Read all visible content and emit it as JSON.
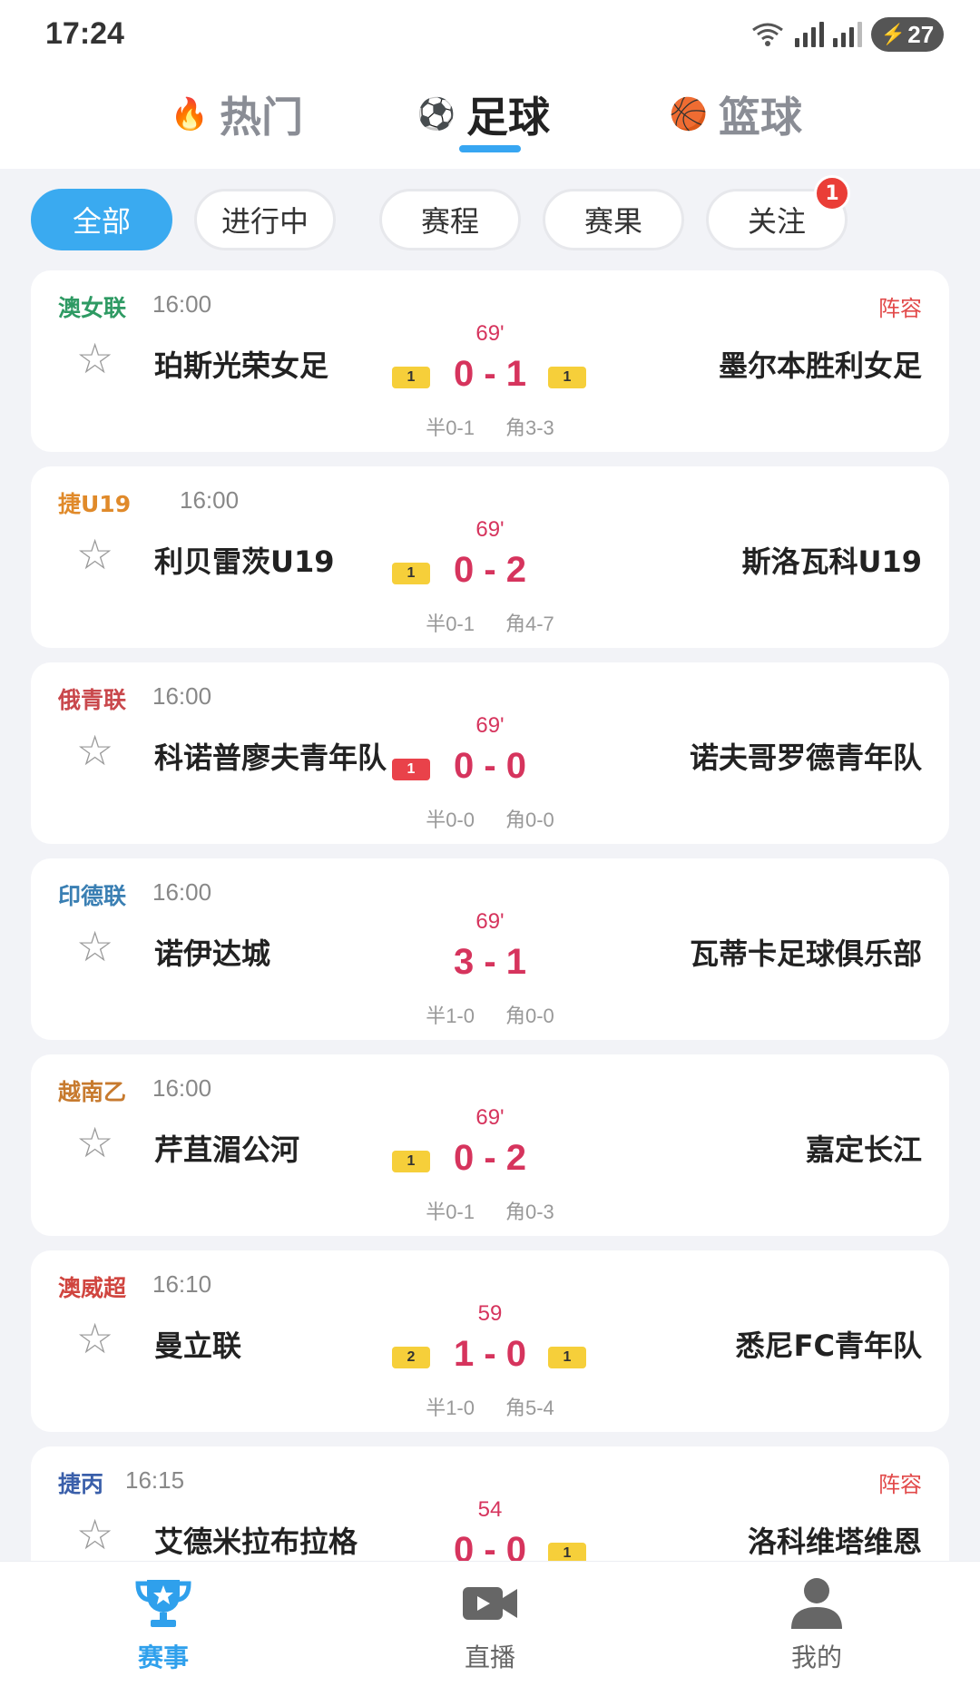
{
  "status_bar": {
    "time": "17:24",
    "battery": "27"
  },
  "sport_tabs": [
    {
      "emoji": "🔥",
      "label": "热门",
      "active": false
    },
    {
      "emoji": "⚽",
      "label": "足球",
      "active": true
    },
    {
      "emoji": "🏀",
      "label": "篮球",
      "active": false
    }
  ],
  "filters": [
    {
      "label": "全部",
      "active": true
    },
    {
      "label": "进行中",
      "active": false
    },
    {
      "label": "赛程",
      "active": false
    },
    {
      "label": "赛果",
      "active": false
    },
    {
      "label": "关注",
      "active": false,
      "badge": "1"
    }
  ],
  "colors": {
    "accent": "#3aaaf0",
    "score": "#d6345d",
    "badge": "#ea3e37"
  },
  "matches": [
    {
      "league": "澳女联",
      "league_color": "#2e9a63",
      "time": "16:00",
      "lineup": "阵容",
      "home": "珀斯光荣女足",
      "away": "墨尔本胜利女足",
      "minute": "69'",
      "score": "0 - 1",
      "home_card": {
        "n": "1",
        "color": "yellow"
      },
      "away_card": {
        "n": "1",
        "color": "yellow"
      },
      "half": "半0-1",
      "corner": "角3-3"
    },
    {
      "league": "捷U19",
      "league_color": "#e08a2a",
      "time": "16:00",
      "lineup": "",
      "home": "利贝雷茨U19",
      "away": "斯洛瓦科U19",
      "minute": "69'",
      "score": "0 - 2",
      "home_card": {
        "n": "1",
        "color": "yellow"
      },
      "away_card": null,
      "half": "半0-1",
      "corner": "角4-7"
    },
    {
      "league": "俄青联",
      "league_color": "#c9484c",
      "time": "16:00",
      "lineup": "",
      "home": "科诺普廖夫青年队",
      "away": "诺夫哥罗德青年队",
      "minute": "69'",
      "score": "0 - 0",
      "home_card": {
        "n": "1",
        "color": "red"
      },
      "away_card": null,
      "half": "半0-0",
      "corner": "角0-0"
    },
    {
      "league": "印德联",
      "league_color": "#3a7fb3",
      "time": "16:00",
      "lineup": "",
      "home": "诺伊达城",
      "away": "瓦蒂卡足球俱乐部",
      "minute": "69'",
      "score": "3 - 1",
      "home_card": null,
      "away_card": null,
      "half": "半1-0",
      "corner": "角0-0"
    },
    {
      "league": "越南乙",
      "league_color": "#c77a2e",
      "time": "16:00",
      "lineup": "",
      "home": "芹苴湄公河",
      "away": "嘉定长江",
      "minute": "69'",
      "score": "0 - 2",
      "home_card": {
        "n": "1",
        "color": "yellow"
      },
      "away_card": null,
      "half": "半0-1",
      "corner": "角0-3"
    },
    {
      "league": "澳威超",
      "league_color": "#d0453f",
      "time": "16:10",
      "lineup": "",
      "home": "曼立联",
      "away": "悉尼FC青年队",
      "minute": "59",
      "score": "1 - 0",
      "home_card": {
        "n": "2",
        "color": "yellow"
      },
      "away_card": {
        "n": "1",
        "color": "yellow"
      },
      "half": "半1-0",
      "corner": "角5-4"
    },
    {
      "league": "捷丙",
      "league_color": "#3a5faa",
      "time": "16:15",
      "lineup": "阵容",
      "home": "艾德米拉布拉格",
      "away": "洛科维塔维恩",
      "minute": "54",
      "score": "0 - 0",
      "home_card": null,
      "away_card": {
        "n": "1",
        "color": "yellow"
      },
      "half": "",
      "corner": ""
    }
  ],
  "bottom_nav": [
    {
      "icon": "trophy-icon",
      "label": "赛事",
      "active": true
    },
    {
      "icon": "video-camera-icon",
      "label": "直播",
      "active": false
    },
    {
      "icon": "user-icon",
      "label": "我的",
      "active": false
    }
  ]
}
